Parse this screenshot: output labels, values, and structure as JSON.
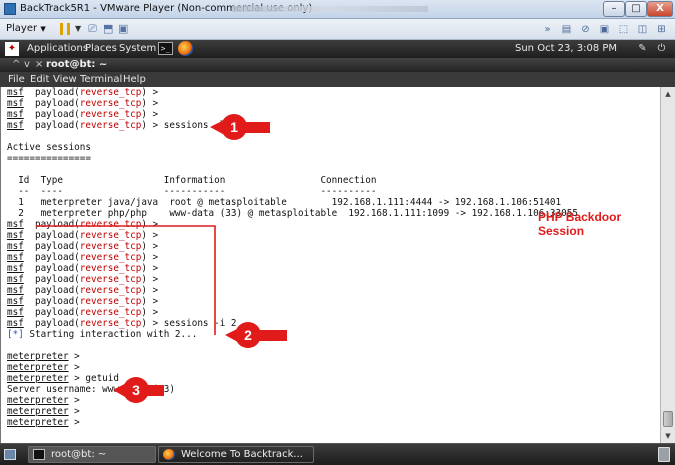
{
  "vmware": {
    "title": "BackTrack5R1 - VMware Player (Non-commercial use only)",
    "player_menu": "Player",
    "window_controls": {
      "minimize": "–",
      "maximize": "□",
      "close": "X"
    },
    "toolbar_right_icons": [
      "»",
      "▤",
      "⊘",
      "▣",
      "⬚",
      "◫",
      "⊞"
    ]
  },
  "gnome_panel": {
    "logo": "✦",
    "menus": [
      "Applications",
      "Places",
      "System"
    ],
    "terminal_launcher": ">_",
    "clock": "Sun Oct 23,  3:08 PM",
    "tray_icons": [
      "✎",
      "⏻"
    ]
  },
  "terminal": {
    "title": "root@bt: ~",
    "title_controls": [
      "^",
      "v",
      "×"
    ],
    "menu": [
      "File",
      "Edit",
      "View",
      "Terminal",
      "Help"
    ],
    "lines": [
      {
        "type": "prompt",
        "cmd": ""
      },
      {
        "type": "prompt",
        "cmd": ""
      },
      {
        "type": "prompt",
        "cmd": ""
      },
      {
        "type": "prompt",
        "cmd": "sessions -l"
      },
      {
        "type": "plain",
        "text": ""
      },
      {
        "type": "plain",
        "text": "Active sessions"
      },
      {
        "type": "plain",
        "text": "==============="
      },
      {
        "type": "plain",
        "text": ""
      },
      {
        "type": "plain",
        "text": "  Id  Type                  Information                 Connection"
      },
      {
        "type": "plain",
        "text": "  --  ----                  -----------                 ----------"
      },
      {
        "type": "plain",
        "text": "  1   meterpreter java/java  root @ metasploitable        192.168.1.111:4444 -> 192.168.1.106:51401"
      },
      {
        "type": "plain",
        "text": "  2   meterpreter php/php    www-data (33) @ metasploitable  192.168.1.111:1099 -> 192.168.1.106:33055"
      },
      {
        "type": "prompt",
        "cmd": ""
      },
      {
        "type": "prompt",
        "cmd": ""
      },
      {
        "type": "prompt",
        "cmd": ""
      },
      {
        "type": "prompt",
        "cmd": ""
      },
      {
        "type": "prompt",
        "cmd": ""
      },
      {
        "type": "prompt",
        "cmd": ""
      },
      {
        "type": "prompt",
        "cmd": ""
      },
      {
        "type": "prompt",
        "cmd": ""
      },
      {
        "type": "prompt",
        "cmd": ""
      },
      {
        "type": "prompt",
        "cmd": "sessions -i 2"
      },
      {
        "type": "info",
        "star": "[*]",
        "text": " Starting interaction with 2..."
      },
      {
        "type": "plain",
        "text": ""
      },
      {
        "type": "meter",
        "cmd": ""
      },
      {
        "type": "meter",
        "cmd": ""
      },
      {
        "type": "meter",
        "cmd": "getuid"
      },
      {
        "type": "plain",
        "text": "Server username: www-data (33)"
      },
      {
        "type": "meter",
        "cmd": ""
      },
      {
        "type": "meter",
        "cmd": ""
      },
      {
        "type": "meter",
        "cmd": ""
      }
    ],
    "prompt_parts": {
      "msf": "msf",
      "payload": "  payload(",
      "module": "reverse_tcp",
      "close": ") > "
    },
    "meter_prompt": {
      "name": "meterpreter",
      "sep": " > "
    }
  },
  "annotations": {
    "badges": [
      "1",
      "2",
      "3"
    ],
    "callout": [
      "PHP Backdoor",
      "Session"
    ],
    "color": "#e11a1a"
  },
  "taskbar": {
    "items": [
      "root@bt: ~",
      "Welcome To Backtrack..."
    ]
  }
}
